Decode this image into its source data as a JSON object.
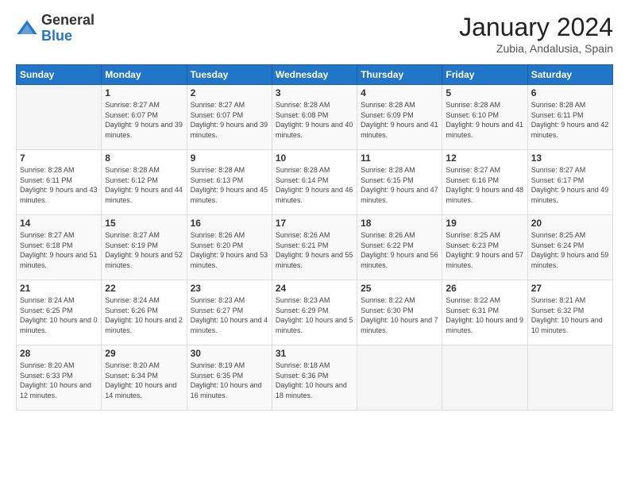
{
  "logo": {
    "general": "General",
    "blue": "Blue"
  },
  "title": "January 2024",
  "location": "Zubia, Andalusia, Spain",
  "days_of_week": [
    "Sunday",
    "Monday",
    "Tuesday",
    "Wednesday",
    "Thursday",
    "Friday",
    "Saturday"
  ],
  "weeks": [
    [
      {
        "day": "",
        "sunrise": "",
        "sunset": "",
        "daylight": ""
      },
      {
        "day": "1",
        "sunrise": "Sunrise: 8:27 AM",
        "sunset": "Sunset: 6:07 PM",
        "daylight": "Daylight: 9 hours and 39 minutes."
      },
      {
        "day": "2",
        "sunrise": "Sunrise: 8:27 AM",
        "sunset": "Sunset: 6:07 PM",
        "daylight": "Daylight: 9 hours and 39 minutes."
      },
      {
        "day": "3",
        "sunrise": "Sunrise: 8:28 AM",
        "sunset": "Sunset: 6:08 PM",
        "daylight": "Daylight: 9 hours and 40 minutes."
      },
      {
        "day": "4",
        "sunrise": "Sunrise: 8:28 AM",
        "sunset": "Sunset: 6:09 PM",
        "daylight": "Daylight: 9 hours and 41 minutes."
      },
      {
        "day": "5",
        "sunrise": "Sunrise: 8:28 AM",
        "sunset": "Sunset: 6:10 PM",
        "daylight": "Daylight: 9 hours and 41 minutes."
      },
      {
        "day": "6",
        "sunrise": "Sunrise: 8:28 AM",
        "sunset": "Sunset: 6:11 PM",
        "daylight": "Daylight: 9 hours and 42 minutes."
      }
    ],
    [
      {
        "day": "7",
        "sunrise": "Sunrise: 8:28 AM",
        "sunset": "Sunset: 6:11 PM",
        "daylight": "Daylight: 9 hours and 43 minutes."
      },
      {
        "day": "8",
        "sunrise": "Sunrise: 8:28 AM",
        "sunset": "Sunset: 6:12 PM",
        "daylight": "Daylight: 9 hours and 44 minutes."
      },
      {
        "day": "9",
        "sunrise": "Sunrise: 8:28 AM",
        "sunset": "Sunset: 6:13 PM",
        "daylight": "Daylight: 9 hours and 45 minutes."
      },
      {
        "day": "10",
        "sunrise": "Sunrise: 8:28 AM",
        "sunset": "Sunset: 6:14 PM",
        "daylight": "Daylight: 9 hours and 46 minutes."
      },
      {
        "day": "11",
        "sunrise": "Sunrise: 8:28 AM",
        "sunset": "Sunset: 6:15 PM",
        "daylight": "Daylight: 9 hours and 47 minutes."
      },
      {
        "day": "12",
        "sunrise": "Sunrise: 8:27 AM",
        "sunset": "Sunset: 6:16 PM",
        "daylight": "Daylight: 9 hours and 48 minutes."
      },
      {
        "day": "13",
        "sunrise": "Sunrise: 8:27 AM",
        "sunset": "Sunset: 6:17 PM",
        "daylight": "Daylight: 9 hours and 49 minutes."
      }
    ],
    [
      {
        "day": "14",
        "sunrise": "Sunrise: 8:27 AM",
        "sunset": "Sunset: 6:18 PM",
        "daylight": "Daylight: 9 hours and 51 minutes."
      },
      {
        "day": "15",
        "sunrise": "Sunrise: 8:27 AM",
        "sunset": "Sunset: 6:19 PM",
        "daylight": "Daylight: 9 hours and 52 minutes."
      },
      {
        "day": "16",
        "sunrise": "Sunrise: 8:26 AM",
        "sunset": "Sunset: 6:20 PM",
        "daylight": "Daylight: 9 hours and 53 minutes."
      },
      {
        "day": "17",
        "sunrise": "Sunrise: 8:26 AM",
        "sunset": "Sunset: 6:21 PM",
        "daylight": "Daylight: 9 hours and 55 minutes."
      },
      {
        "day": "18",
        "sunrise": "Sunrise: 8:26 AM",
        "sunset": "Sunset: 6:22 PM",
        "daylight": "Daylight: 9 hours and 56 minutes."
      },
      {
        "day": "19",
        "sunrise": "Sunrise: 8:25 AM",
        "sunset": "Sunset: 6:23 PM",
        "daylight": "Daylight: 9 hours and 57 minutes."
      },
      {
        "day": "20",
        "sunrise": "Sunrise: 8:25 AM",
        "sunset": "Sunset: 6:24 PM",
        "daylight": "Daylight: 9 hours and 59 minutes."
      }
    ],
    [
      {
        "day": "21",
        "sunrise": "Sunrise: 8:24 AM",
        "sunset": "Sunset: 6:25 PM",
        "daylight": "Daylight: 10 hours and 0 minutes."
      },
      {
        "day": "22",
        "sunrise": "Sunrise: 8:24 AM",
        "sunset": "Sunset: 6:26 PM",
        "daylight": "Daylight: 10 hours and 2 minutes."
      },
      {
        "day": "23",
        "sunrise": "Sunrise: 8:23 AM",
        "sunset": "Sunset: 6:27 PM",
        "daylight": "Daylight: 10 hours and 4 minutes."
      },
      {
        "day": "24",
        "sunrise": "Sunrise: 8:23 AM",
        "sunset": "Sunset: 6:29 PM",
        "daylight": "Daylight: 10 hours and 5 minutes."
      },
      {
        "day": "25",
        "sunrise": "Sunrise: 8:22 AM",
        "sunset": "Sunset: 6:30 PM",
        "daylight": "Daylight: 10 hours and 7 minutes."
      },
      {
        "day": "26",
        "sunrise": "Sunrise: 8:22 AM",
        "sunset": "Sunset: 6:31 PM",
        "daylight": "Daylight: 10 hours and 9 minutes."
      },
      {
        "day": "27",
        "sunrise": "Sunrise: 8:21 AM",
        "sunset": "Sunset: 6:32 PM",
        "daylight": "Daylight: 10 hours and 10 minutes."
      }
    ],
    [
      {
        "day": "28",
        "sunrise": "Sunrise: 8:20 AM",
        "sunset": "Sunset: 6:33 PM",
        "daylight": "Daylight: 10 hours and 12 minutes."
      },
      {
        "day": "29",
        "sunrise": "Sunrise: 8:20 AM",
        "sunset": "Sunset: 6:34 PM",
        "daylight": "Daylight: 10 hours and 14 minutes."
      },
      {
        "day": "30",
        "sunrise": "Sunrise: 8:19 AM",
        "sunset": "Sunset: 6:35 PM",
        "daylight": "Daylight: 10 hours and 16 minutes."
      },
      {
        "day": "31",
        "sunrise": "Sunrise: 8:18 AM",
        "sunset": "Sunset: 6:36 PM",
        "daylight": "Daylight: 10 hours and 18 minutes."
      },
      {
        "day": "",
        "sunrise": "",
        "sunset": "",
        "daylight": ""
      },
      {
        "day": "",
        "sunrise": "",
        "sunset": "",
        "daylight": ""
      },
      {
        "day": "",
        "sunrise": "",
        "sunset": "",
        "daylight": ""
      }
    ]
  ]
}
